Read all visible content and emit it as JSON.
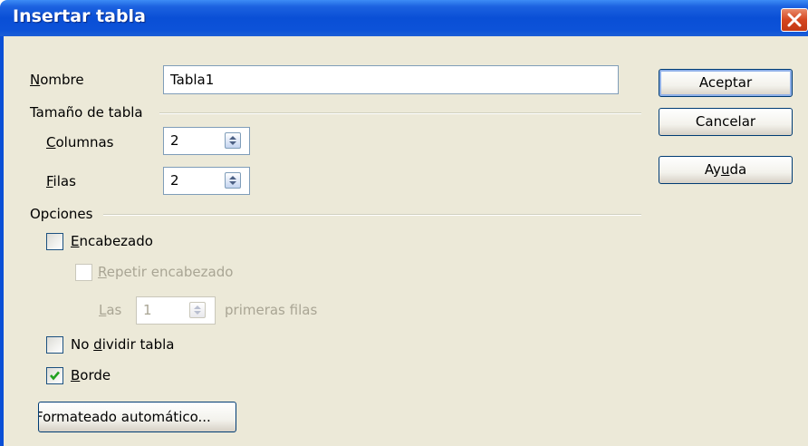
{
  "window": {
    "title": "Insertar tabla"
  },
  "name_field": {
    "label_first": "N",
    "label_rest": "ombre",
    "value": "Tabla1"
  },
  "table_size": {
    "section_label": "Tamaño de tabla",
    "columns": {
      "label_first": "C",
      "label_rest": "olumnas",
      "value": "2"
    },
    "rows": {
      "label_first": "F",
      "label_rest": "ilas",
      "value": "2"
    }
  },
  "options": {
    "section_label": "Opciones",
    "header": {
      "label_first": "E",
      "label_rest": "ncabezado",
      "checked": false
    },
    "repeat_header": {
      "label_first": "R",
      "label_rest": "epetir encabezado",
      "checked": false,
      "enabled": false
    },
    "repeat_rows": {
      "prefix_first": "L",
      "prefix_rest": "as",
      "value": "1",
      "suffix": "primeras filas"
    },
    "dont_split": {
      "label_before": "No ",
      "label_accel": "d",
      "label_after": "ividir tabla",
      "checked": false
    },
    "border": {
      "label_first": "B",
      "label_rest": "orde",
      "checked": true
    },
    "autoformat_button": "Formateado automático..."
  },
  "buttons": {
    "ok": "Aceptar",
    "cancel": "Cancelar",
    "help_before": "Ay",
    "help_accel": "u",
    "help_after": "da"
  },
  "colors": {
    "titlebar": "#0a4fd6",
    "dialog_bg": "#ece9d8",
    "close_button": "#d5461f",
    "disabled_text": "#a9a594"
  }
}
